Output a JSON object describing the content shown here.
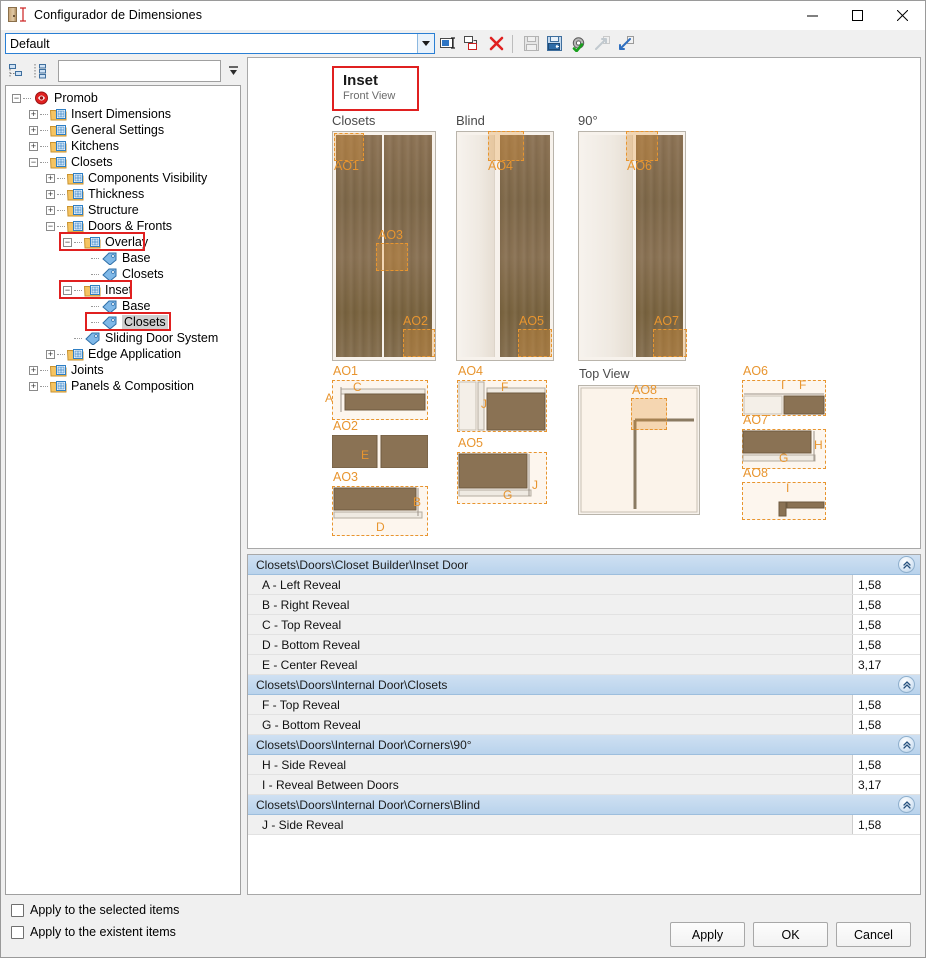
{
  "window": {
    "title": "Configurador de Dimensiones",
    "icon": "door-dimension-icon",
    "minimize_label": "–",
    "maximize_label": "□",
    "close_label": "✕"
  },
  "profile_bar": {
    "combo_value": "Default",
    "combo_placeholder": "Default",
    "dropdown_icon": "chevron-down-icon",
    "tools": [
      {
        "name": "rename-configuration-button",
        "icon": "rename-icon",
        "enabled": true
      },
      {
        "name": "duplicate-configuration-button",
        "icon": "duplicate-icon",
        "enabled": true
      },
      {
        "name": "delete-configuration-button",
        "icon": "delete-x-icon",
        "enabled": true
      },
      {
        "name": "save-button",
        "icon": "floppy-disk-icon",
        "enabled": false
      },
      {
        "name": "save-as-button",
        "icon": "save-as-icon",
        "enabled": true
      },
      {
        "name": "settings-apply-button",
        "icon": "gear-check-icon",
        "enabled": true
      },
      {
        "name": "export-button",
        "icon": "export-arrow-icon",
        "enabled": false
      },
      {
        "name": "import-button",
        "icon": "import-arrow-icon",
        "enabled": true
      }
    ]
  },
  "tree_panel": {
    "toolbar": [
      {
        "name": "collapse-all-button",
        "icon": "collapse-tree-icon"
      },
      {
        "name": "expand-all-button",
        "icon": "expand-tree-icon"
      }
    ],
    "search_value": "",
    "search_placeholder": "",
    "search_dropdown_icon": "filter-dropdown-icon",
    "nodes": [
      {
        "label": "Promob",
        "depth": 0,
        "expander": "minus",
        "icon": "promob-logo-icon",
        "selected": false,
        "highlight": false
      },
      {
        "label": "Insert Dimensions",
        "depth": 1,
        "expander": "plus",
        "icon": "folder-icon",
        "selected": false,
        "highlight": false
      },
      {
        "label": "General Settings",
        "depth": 1,
        "expander": "plus",
        "icon": "folder-icon",
        "selected": false,
        "highlight": false
      },
      {
        "label": "Kitchens",
        "depth": 1,
        "expander": "plus",
        "icon": "folder-icon",
        "selected": false,
        "highlight": false
      },
      {
        "label": "Closets",
        "depth": 1,
        "expander": "minus",
        "icon": "folder-icon",
        "selected": false,
        "highlight": false
      },
      {
        "label": "Components Visibility",
        "depth": 2,
        "expander": "plus",
        "icon": "folder-icon",
        "selected": false,
        "highlight": false
      },
      {
        "label": "Thickness",
        "depth": 2,
        "expander": "plus",
        "icon": "folder-icon",
        "selected": false,
        "highlight": false
      },
      {
        "label": "Structure",
        "depth": 2,
        "expander": "plus",
        "icon": "folder-icon",
        "selected": false,
        "highlight": false
      },
      {
        "label": "Doors & Fronts",
        "depth": 2,
        "expander": "minus",
        "icon": "folder-icon",
        "selected": false,
        "highlight": false
      },
      {
        "label": "Overlay",
        "depth": 3,
        "expander": "minus",
        "icon": "folder-icon",
        "selected": false,
        "highlight": true
      },
      {
        "label": "Base",
        "depth": 4,
        "expander": "none",
        "icon": "tag-icon",
        "selected": false,
        "highlight": false
      },
      {
        "label": "Closets",
        "depth": 4,
        "expander": "none",
        "icon": "tag-icon",
        "selected": false,
        "highlight": false
      },
      {
        "label": "Inset",
        "depth": 3,
        "expander": "minus",
        "icon": "folder-icon",
        "selected": false,
        "highlight": true
      },
      {
        "label": "Base",
        "depth": 4,
        "expander": "none",
        "icon": "tag-icon",
        "selected": false,
        "highlight": false
      },
      {
        "label": "Closets",
        "depth": 4,
        "expander": "none",
        "icon": "tag-icon",
        "selected": true,
        "highlight": true
      },
      {
        "label": "Sliding Door System",
        "depth": 3,
        "expander": "none",
        "icon": "tag-icon",
        "selected": false,
        "highlight": false
      },
      {
        "label": "Edge Application",
        "depth": 2,
        "expander": "plus",
        "icon": "folder-icon",
        "selected": false,
        "highlight": false
      },
      {
        "label": "Joints",
        "depth": 1,
        "expander": "plus",
        "icon": "folder-icon",
        "selected": false,
        "highlight": false
      },
      {
        "label": "Panels & Composition",
        "depth": 1,
        "expander": "plus",
        "icon": "folder-icon",
        "selected": false,
        "highlight": false
      }
    ]
  },
  "preview": {
    "title": "Inset",
    "subtitle": "Front View",
    "column_labels": [
      "Closets",
      "Blind",
      "90°"
    ],
    "top_view_label": "Top View",
    "callouts": [
      "AO1",
      "AO2",
      "AO3",
      "AO4",
      "AO5",
      "AO6",
      "AO7",
      "AO8"
    ],
    "detail_views": [
      {
        "id": "AO1",
        "letters": [
          "A",
          "C"
        ]
      },
      {
        "id": "AO2",
        "letters": [
          "E"
        ]
      },
      {
        "id": "AO3",
        "letters": [
          "B",
          "D"
        ]
      },
      {
        "id": "AO4",
        "letters": [
          "F",
          "J"
        ]
      },
      {
        "id": "AO5",
        "letters": [
          "G",
          "J"
        ]
      },
      {
        "id": "AO6",
        "letters": [
          "I",
          "F"
        ]
      },
      {
        "id": "AO7",
        "letters": [
          "H",
          "G"
        ]
      },
      {
        "id": "AO8",
        "letters": [
          "I"
        ]
      }
    ],
    "accent_color": "#e8952f",
    "highlight_color": "#e02020"
  },
  "properties": {
    "groups": [
      {
        "title": "Closets\\Doors\\Closet Builder\\Inset Door",
        "collapse_icon": "chevron-double-up-icon",
        "rows": [
          {
            "label": "A - Left Reveal",
            "value": "1,58"
          },
          {
            "label": "B - Right Reveal",
            "value": "1,58"
          },
          {
            "label": "C - Top Reveal",
            "value": "1,58"
          },
          {
            "label": "D - Bottom Reveal",
            "value": "1,58"
          },
          {
            "label": "E - Center Reveal",
            "value": "3,17"
          }
        ]
      },
      {
        "title": "Closets\\Doors\\Internal Door\\Closets",
        "collapse_icon": "chevron-double-up-icon",
        "rows": [
          {
            "label": "F - Top Reveal",
            "value": "1,58"
          },
          {
            "label": "G - Bottom Reveal",
            "value": "1,58"
          }
        ]
      },
      {
        "title": "Closets\\Doors\\Internal Door\\Corners\\90°",
        "collapse_icon": "chevron-double-up-icon",
        "rows": [
          {
            "label": "H - Side Reveal",
            "value": "1,58"
          },
          {
            "label": "I - Reveal Between Doors",
            "value": "3,17"
          }
        ]
      },
      {
        "title": "Closets\\Doors\\Internal Door\\Corners\\Blind",
        "collapse_icon": "chevron-double-up-icon",
        "rows": [
          {
            "label": "J - Side Reveal",
            "value": "1,58"
          }
        ]
      }
    ]
  },
  "footer": {
    "checkboxes": [
      {
        "label": "Apply to the selected items",
        "checked": false
      },
      {
        "label": "Apply to the existent items",
        "checked": false
      }
    ],
    "buttons": [
      {
        "label": "Apply",
        "name": "apply-button"
      },
      {
        "label": "OK",
        "name": "ok-button"
      },
      {
        "label": "Cancel",
        "name": "cancel-button"
      }
    ]
  }
}
